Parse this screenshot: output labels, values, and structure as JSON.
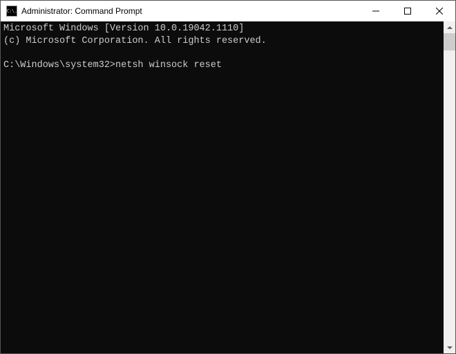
{
  "titlebar": {
    "icon_label": "C:\\.",
    "title": "Administrator: Command Prompt"
  },
  "console": {
    "line1": "Microsoft Windows [Version 10.0.19042.1110]",
    "line2": "(c) Microsoft Corporation. All rights reserved.",
    "blank": "",
    "prompt_path": "C:\\Windows\\system32>",
    "command": "netsh winsock reset"
  }
}
